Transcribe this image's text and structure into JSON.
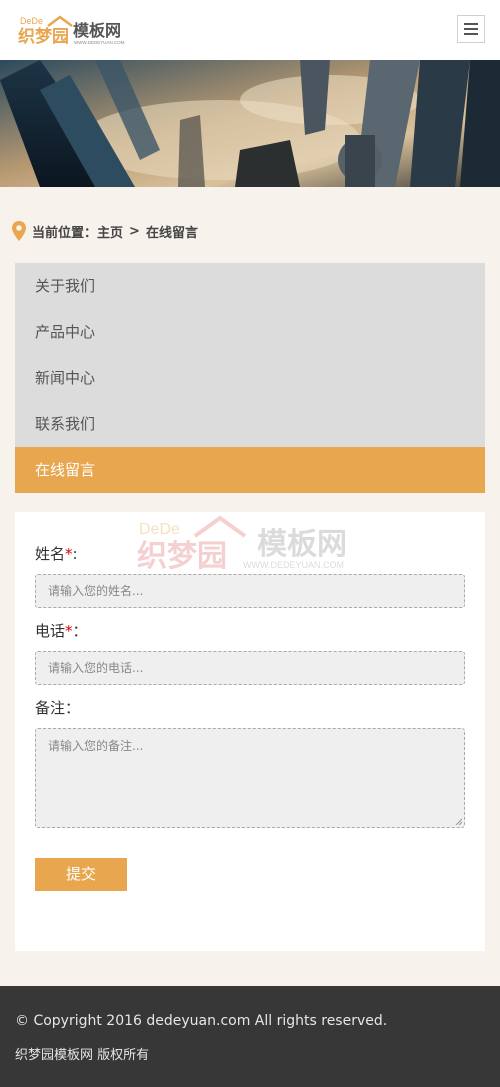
{
  "header": {
    "logo_dede": "DeDe",
    "logo_brand": "织梦园",
    "logo_site": "模板网",
    "logo_url": "WWW.DEDEYUAN.COM"
  },
  "breadcrumb": {
    "prefix": "当前位置：",
    "home": "主页",
    "separator": ">",
    "current": "在线留言"
  },
  "nav": {
    "items": [
      {
        "label": "关于我们"
      },
      {
        "label": "产品中心"
      },
      {
        "label": "新闻中心"
      },
      {
        "label": "联系我们"
      },
      {
        "label": "在线留言",
        "active": true
      }
    ]
  },
  "form": {
    "name_label": "姓名",
    "name_suffix": ":",
    "name_placeholder": "请输入您的姓名...",
    "phone_label": "电话",
    "phone_suffix": "：",
    "phone_placeholder": "请输入您的电话...",
    "note_label": "备注：",
    "note_placeholder": "请输入您的备注...",
    "required_mark": "*",
    "submit_label": "提交"
  },
  "watermark": {
    "dede": "DeDe",
    "brand": "织梦园",
    "site": "模板网",
    "url": "WWW.DEDEYUAN.COM"
  },
  "footer": {
    "copyright": "© Copyright 2016 dedeyuan.com All rights reserved.",
    "rights": "织梦园模板网 版权所有"
  },
  "colors": {
    "accent": "#e8a74f",
    "footer_bg": "#373737",
    "page_bg": "#f7f2ec",
    "nav_bg": "#dcdcdc"
  }
}
